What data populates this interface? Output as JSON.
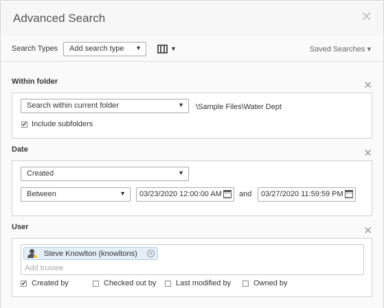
{
  "dialog": {
    "title": "Advanced Search",
    "close_glyph": "✕"
  },
  "toolbar": {
    "search_types_label": "Search Types",
    "search_type_select": "Add search type",
    "columns_icon": "columns-icon",
    "saved_searches": "Saved Searches ▾"
  },
  "within_folder": {
    "title": "Within folder",
    "remove_glyph": "✕",
    "scope_select": "Search within current folder",
    "path": "\\Sample Files\\Water Dept",
    "include_subfolders": {
      "label": "Include subfolders",
      "checked": true
    }
  },
  "date": {
    "title": "Date",
    "remove_glyph": "✕",
    "field_select": "Created",
    "operator_select": "Between",
    "from_value": "03/23/2020 12:00:00 AM",
    "and_label": "and",
    "to_value": "03/27/2020 11:59:59 PM"
  },
  "user": {
    "title": "User",
    "remove_glyph": "✕",
    "trustee_chip": "Steve Knowlton (knowltons)",
    "trustee_placeholder": "Add trustee",
    "options": [
      {
        "label": "Created by",
        "checked": true
      },
      {
        "label": "Checked out by",
        "checked": false
      },
      {
        "label": "Last modified by",
        "checked": false
      },
      {
        "label": "Owned by",
        "checked": false
      }
    ]
  },
  "colors": {
    "panel_border": "#d0d0d0",
    "chip_bg": "#e4eef8",
    "user_badge": "#f2c200"
  }
}
